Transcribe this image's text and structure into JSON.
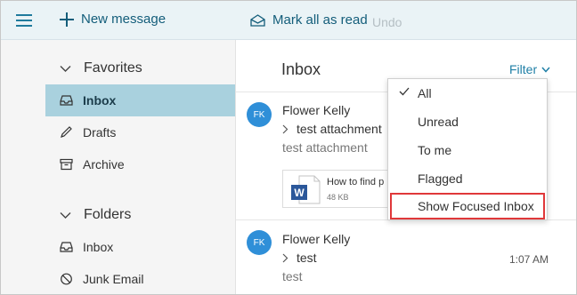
{
  "toolbar": {
    "menu_icon": "hamburger-icon",
    "new_message_label": "New message",
    "mark_all_read_label": "Mark all as read",
    "undo_label": "Undo"
  },
  "sidebar": {
    "favorites_label": "Favorites",
    "folders_label": "Folders",
    "favorites": [
      {
        "label": "Inbox",
        "icon": "inbox-icon",
        "selected": true
      },
      {
        "label": "Drafts",
        "icon": "pencil-icon"
      },
      {
        "label": "Archive",
        "icon": "archive-icon"
      }
    ],
    "folders": [
      {
        "label": "Inbox",
        "icon": "inbox-icon"
      },
      {
        "label": "Junk Email",
        "icon": "blocked-icon"
      }
    ]
  },
  "message_list": {
    "title": "Inbox",
    "filter_label": "Filter",
    "messages": [
      {
        "avatar": "FK",
        "sender": "Flower Kelly",
        "subject": "test attachment",
        "preview": "test attachment",
        "time": "",
        "attachment": {
          "name": "How to find p",
          "size": "48 KB"
        }
      },
      {
        "avatar": "FK",
        "sender": "Flower Kelly",
        "subject": "test",
        "preview": "test",
        "time": "1:07 AM"
      }
    ]
  },
  "filter_menu": {
    "items": [
      {
        "label": "All",
        "checked": true
      },
      {
        "label": "Unread"
      },
      {
        "label": "To me"
      },
      {
        "label": "Flagged"
      },
      {
        "label": "Show Focused Inbox",
        "highlighted": true
      }
    ]
  },
  "colors": {
    "accent": "#1f7a9c",
    "selected_bg": "#a9d1de",
    "avatar_bg": "#2f8fd8",
    "highlight_border": "#e0383a"
  }
}
